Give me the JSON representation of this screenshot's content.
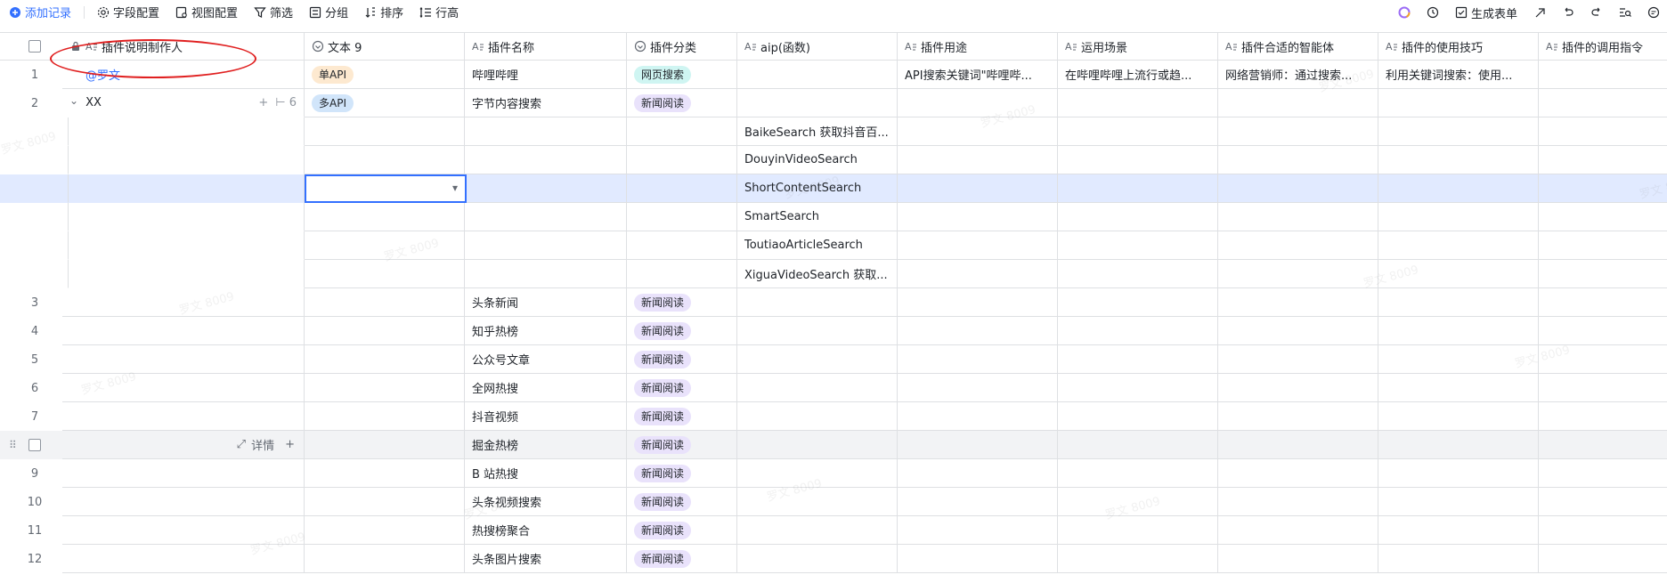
{
  "toolbar": {
    "add_record": "添加记录",
    "field_config": "字段配置",
    "view_config": "视图配置",
    "filter": "筛选",
    "group": "分组",
    "sort": "排序",
    "row_height": "行高",
    "generate_form": "生成表单"
  },
  "columns": [
    {
      "label": "插件说明制作人",
      "icon": "text-icon",
      "locked": true
    },
    {
      "label": "文本 9",
      "icon": "select-icon"
    },
    {
      "label": "插件名称",
      "icon": "text-icon"
    },
    {
      "label": "插件分类",
      "icon": "select-icon"
    },
    {
      "label": "aip(函数)",
      "icon": "text-icon"
    },
    {
      "label": "插件用途",
      "icon": "text-icon"
    },
    {
      "label": "运用场景",
      "icon": "text-icon"
    },
    {
      "label": "插件合适的智能体",
      "icon": "text-icon"
    },
    {
      "label": "插件的使用技巧",
      "icon": "text-icon"
    },
    {
      "label": "插件的调用指令",
      "icon": "text-icon"
    }
  ],
  "rows": [
    {
      "num": "1",
      "author": "@罗文",
      "text9": "单API",
      "name": "哔哩哔哩",
      "category": "网页搜索",
      "aip": "",
      "purpose": "API搜索关键词\"哔哩哔...",
      "scene": "在哔哩哔哩上流行或趋...",
      "agent": "网络营销师：通过搜索...",
      "tips": "利用关键词搜索：使用..."
    },
    {
      "num": "2",
      "author": "XX",
      "sub_count": "6",
      "text9": "多API",
      "name": "字节内容搜索",
      "category": "新闻阅读",
      "aip": ""
    },
    {
      "aip": "BaikeSearch 获取抖音百..."
    },
    {
      "aip": "DouyinVideoSearch"
    },
    {
      "aip": "ShortContentSearch"
    },
    {
      "aip": "SmartSearch"
    },
    {
      "aip": "ToutiaoArticleSearch"
    },
    {
      "aip": "XiguaVideoSearch 获取..."
    },
    {
      "num": "3",
      "name": "头条新闻",
      "category": "新闻阅读"
    },
    {
      "num": "4",
      "name": "知乎热榜",
      "category": "新闻阅读"
    },
    {
      "num": "5",
      "name": "公众号文章",
      "category": "新闻阅读"
    },
    {
      "num": "6",
      "name": "全网热搜",
      "category": "新闻阅读"
    },
    {
      "num": "7",
      "name": "抖音视频",
      "category": "新闻阅读"
    },
    {
      "num": "",
      "name": "掘金热榜",
      "category": "新闻阅读",
      "detail": "详情"
    },
    {
      "num": "9",
      "name": "B 站热搜",
      "category": "新闻阅读"
    },
    {
      "num": "10",
      "name": "头条视频搜索",
      "category": "新闻阅读"
    },
    {
      "num": "11",
      "name": "热搜榜聚合",
      "category": "新闻阅读"
    },
    {
      "num": "12",
      "name": "头条图片搜索",
      "category": "新闻阅读"
    }
  ],
  "watermark": "罗文 8009",
  "colors": {
    "accent": "#3370ff",
    "selected_row": "#e1eaff",
    "annotation": "#e02020"
  }
}
